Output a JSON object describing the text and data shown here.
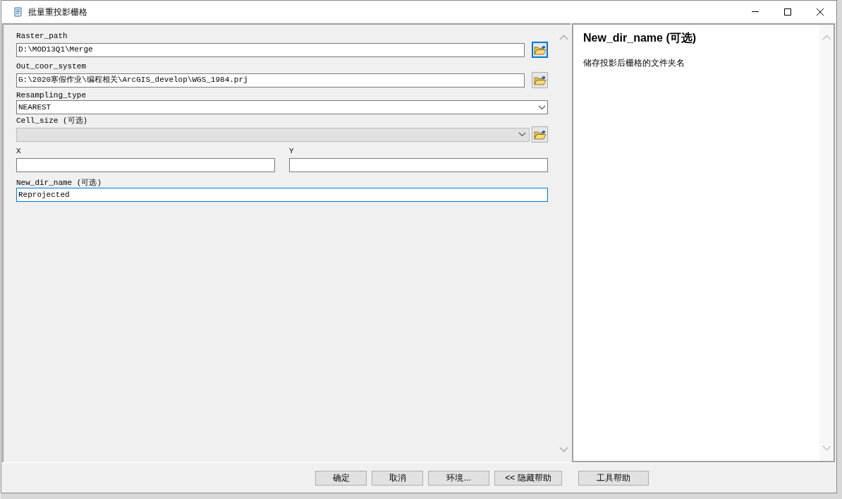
{
  "window": {
    "title": "批量重投影栅格"
  },
  "parameters": [
    {
      "kind": "path",
      "label": "Raster_path",
      "value": "D:\\MOD13Q1\\Merge",
      "focused": false,
      "button_focused": true
    },
    {
      "kind": "path",
      "label": "Out_coor_system",
      "value": "G:\\2020寒假作业\\编程相关\\ArcGIS_develop\\WGS_1984.prj",
      "focused": false,
      "button_focused": false
    },
    {
      "kind": "select",
      "label": "Resampling_type",
      "value": "NEAREST",
      "disabled": false
    },
    {
      "kind": "combo_browse",
      "label": "Cell_size (可选)",
      "disabled": true
    },
    {
      "kind": "xy",
      "fields": [
        {
          "label": "X"
        },
        {
          "label": "Y"
        }
      ]
    },
    {
      "kind": "text",
      "label": "New_dir_name (可选)",
      "value": "Reprojected",
      "focused": true
    }
  ],
  "help": {
    "title": "New_dir_name (可选)",
    "text": "储存投影后栅格的文件夹名"
  },
  "buttons": [
    "确定",
    "取消",
    "环境...",
    "<< 隐藏帮助",
    "工具帮助"
  ]
}
